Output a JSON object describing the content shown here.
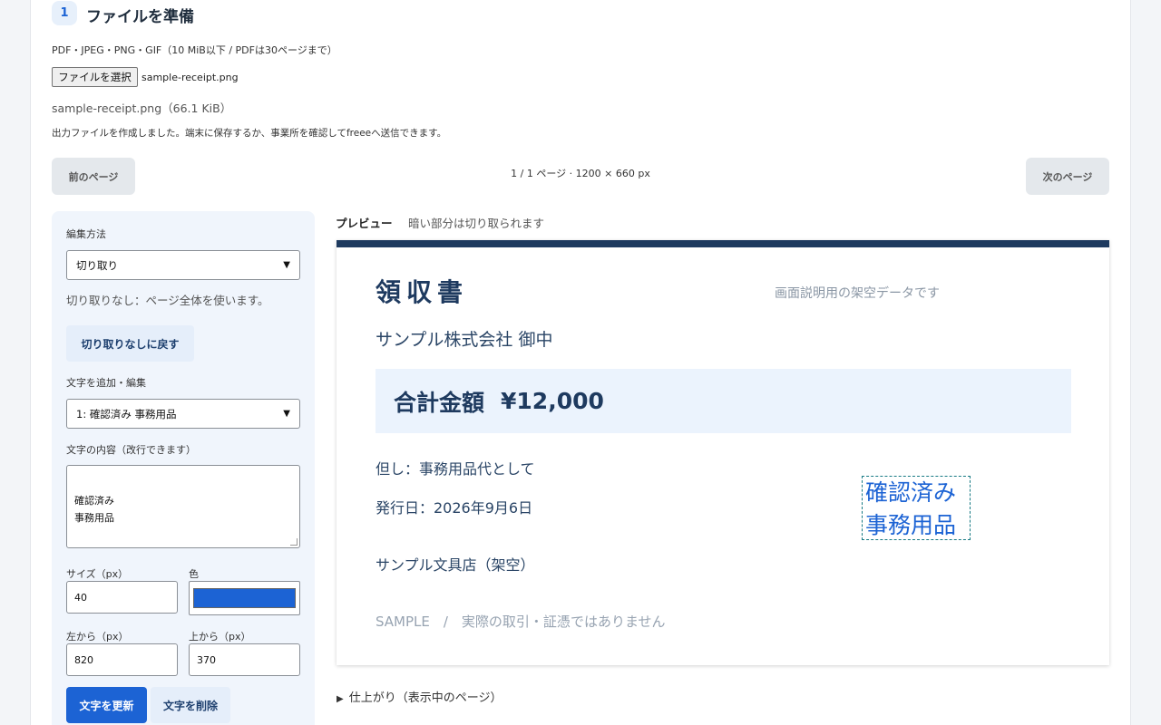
{
  "step": {
    "number": "1",
    "title": "ファイルを準備"
  },
  "upload": {
    "formats_hint": "PDF・JPEG・PNG・GIF（10 MiB以下 / PDFは30ページまで）",
    "choose_button": "ファイルを選択",
    "chosen_file": "sample-receipt.png",
    "file_info": "sample-receipt.png（66.1 KiB）",
    "created_message": "出力ファイルを作成しました。端末に保存するか、事業所を確認してfreeeへ送信できます。"
  },
  "pager": {
    "prev_label": "前のページ",
    "next_label": "次のページ",
    "status": "1 / 1 ページ · 1200 × 660 px"
  },
  "editor": {
    "edit_method_label": "編集方法",
    "edit_method_value": "切り取り",
    "crop_description": "切り取りなし：ページ全体を使います。",
    "reset_crop_button": "切り取りなしに戻す",
    "text_edit_label": "文字を追加・編集",
    "text_select_value": "1: 確認済み 事務用品",
    "text_content_label": "文字の内容（改行できます）",
    "text_content_value": "確認済み\n事務用品",
    "size_label": "サイズ（px）",
    "size_value": "40",
    "color_label": "色",
    "color_value": "#1c63d4",
    "left_label": "左から（px）",
    "left_value": "820",
    "top_label": "上から（px）",
    "top_value": "370",
    "update_button": "文字を更新",
    "delete_button": "文字を削除"
  },
  "preview": {
    "label": "プレビュー",
    "note": "暗い部分は切り取られます",
    "receipt": {
      "title": "領収書",
      "disclaimer": "画面説明用の架空データです",
      "addressee": "サンプル株式会社 御中",
      "total_label": "合計金額",
      "total_amount": "¥12,000",
      "memo": "但し：事務用品代として",
      "issue_date": "発行日：2026年9月6日",
      "issuer": "サンプル文具店（架空）",
      "footer": "SAMPLE　/　実際の取引・証憑ではありません",
      "stamp_text": "確認済み\n事務用品"
    }
  },
  "finish": {
    "label": "仕上がり（表示中のページ）"
  }
}
